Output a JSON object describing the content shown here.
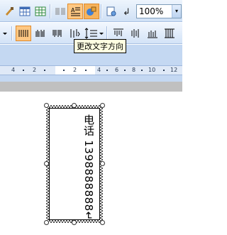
{
  "toolbar_standard": {
    "zoom_value": "100%",
    "zoom_arrow": "▾",
    "buttons": [
      {
        "name": "format-painter-icon"
      },
      {
        "name": "table-icon"
      },
      {
        "name": "insert-excel-icon"
      },
      {
        "name": "columns-icon"
      },
      {
        "name": "text-direction-icon"
      },
      {
        "name": "drawing-icon"
      },
      {
        "name": "document-map-icon"
      },
      {
        "name": "show-hide-icon"
      }
    ]
  },
  "toolbar_formatting": {
    "buttons": [
      {
        "name": "dropdown-arrow-icon"
      },
      {
        "name": "distributed-align-icon"
      },
      {
        "name": "column-lines-icon"
      },
      {
        "name": "column-lines-2-icon"
      },
      {
        "name": "text-align-icon"
      },
      {
        "name": "line-spacing-icon"
      },
      {
        "name": "vertical-align-top-icon"
      },
      {
        "name": "vertical-align-center-icon"
      },
      {
        "name": "vertical-align-bottom-icon"
      },
      {
        "name": "vertical-align-justify-icon"
      }
    ]
  },
  "tooltip": {
    "text": "更改文字方向"
  },
  "ruler": {
    "numbers": [
      "4",
      "2",
      "2",
      "4",
      "6",
      "8",
      "10",
      "12"
    ]
  },
  "textbox": {
    "content": "电话 1398888888↵"
  },
  "colors": {
    "toolbar_bg": "#cfe0f5",
    "pressed_button": "#ffc883",
    "tooltip_bg": "#ffffe1",
    "ruler_bg": "#dfe9f7"
  }
}
